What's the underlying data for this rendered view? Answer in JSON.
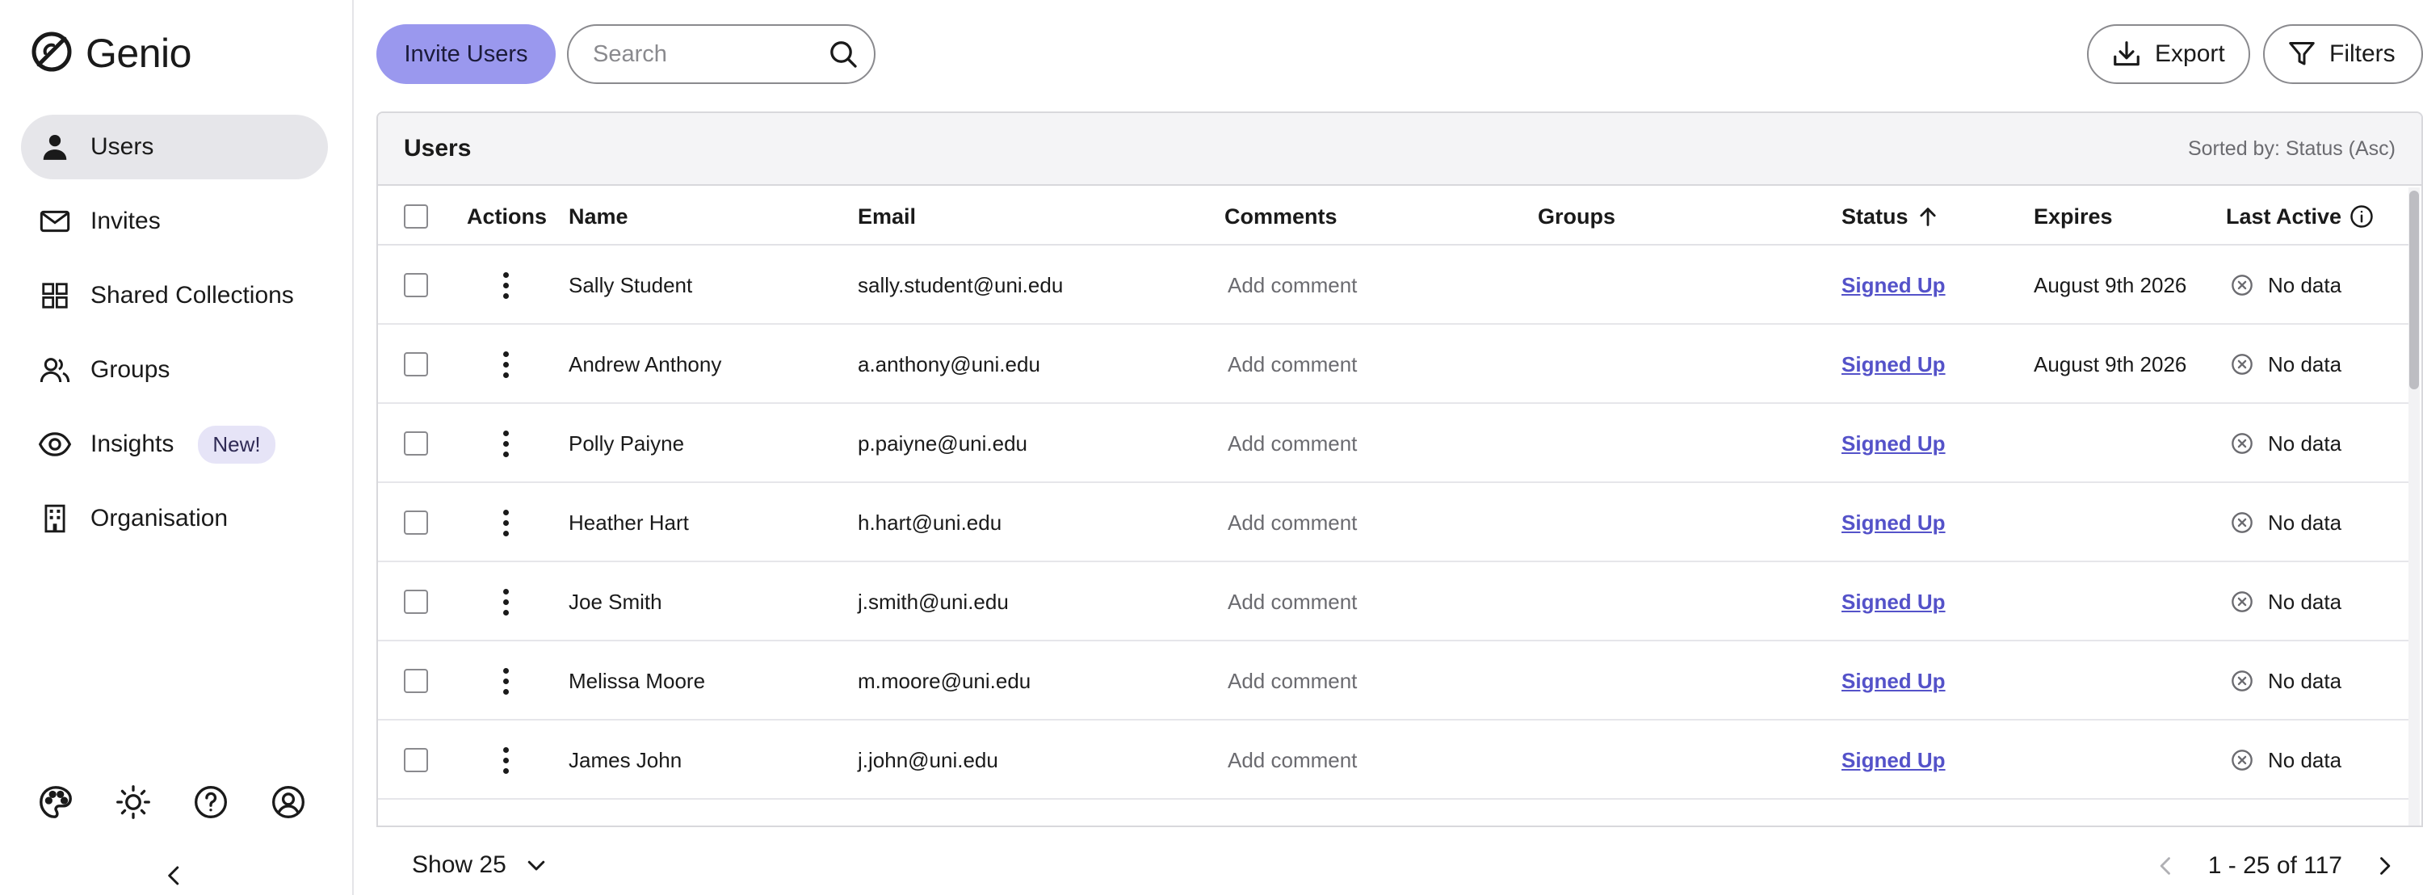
{
  "app": {
    "name": "Genio",
    "logo_icon": "genio-logo-icon"
  },
  "sidebar": {
    "items": [
      {
        "label": "Users",
        "icon": "user-icon",
        "active": true
      },
      {
        "label": "Invites",
        "icon": "mail-icon"
      },
      {
        "label": "Shared Collections",
        "icon": "grid-icon"
      },
      {
        "label": "Groups",
        "icon": "users-icon"
      },
      {
        "label": "Insights",
        "icon": "eye-icon",
        "badge": "New!"
      },
      {
        "label": "Organisation",
        "icon": "building-icon"
      }
    ],
    "bottom_icons": [
      "palette-icon",
      "sun-icon",
      "help-icon",
      "account-icon"
    ],
    "collapse_icon": "chevron-left-icon"
  },
  "toolbar": {
    "invite_label": "Invite Users",
    "search_placeholder": "Search",
    "export_label": "Export",
    "filters_label": "Filters"
  },
  "table": {
    "title": "Users",
    "sorted_by": "Sorted by: Status (Asc)",
    "columns": [
      "Actions",
      "Name",
      "Email",
      "Comments",
      "Groups",
      "Status",
      "Expires",
      "Last Active"
    ],
    "rows": [
      {
        "name": "Sally Student",
        "email": "sally.student@uni.edu",
        "comment": "Add comment",
        "groups": "",
        "status": "Signed Up",
        "expires": "August 9th 2026",
        "last_active": "No data"
      },
      {
        "name": "Andrew Anthony",
        "email": "a.anthony@uni.edu",
        "comment": "Add comment",
        "groups": "",
        "status": "Signed Up",
        "expires": "August 9th 2026",
        "last_active": "No data"
      },
      {
        "name": "Polly Paiyne",
        "email": "p.paiyne@uni.edu",
        "comment": "Add comment",
        "groups": "",
        "status": "Signed Up",
        "expires": "",
        "last_active": "No data"
      },
      {
        "name": "Heather Hart",
        "email": "h.hart@uni.edu",
        "comment": "Add comment",
        "groups": "",
        "status": "Signed Up",
        "expires": "",
        "last_active": "No data"
      },
      {
        "name": "Joe Smith",
        "email": "j.smith@uni.edu",
        "comment": "Add comment",
        "groups": "",
        "status": "Signed Up",
        "expires": "",
        "last_active": "No data"
      },
      {
        "name": "Melissa Moore",
        "email": "m.moore@uni.edu",
        "comment": "Add comment",
        "groups": "",
        "status": "Signed Up",
        "expires": "",
        "last_active": "No data"
      },
      {
        "name": "James John",
        "email": "j.john@uni.edu",
        "comment": "Add comment",
        "groups": "",
        "status": "Signed Up",
        "expires": "",
        "last_active": "No data"
      }
    ]
  },
  "footer": {
    "show_label": "Show 25",
    "range_label": "1 - 25 of 117"
  },
  "colors": {
    "accent": "#9a98ee",
    "link": "#5452c9",
    "active_nav": "#e6e6ea",
    "badge_bg": "#e6e4f7"
  }
}
